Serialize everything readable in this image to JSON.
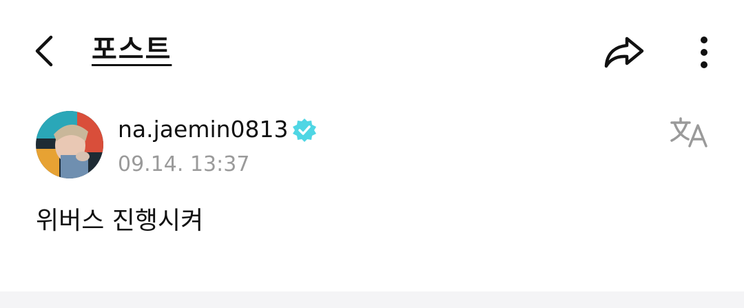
{
  "header": {
    "title": "포스트",
    "back_icon": "chevron-left-icon",
    "share_icon": "share-arrow-icon",
    "more_icon": "more-vertical-icon"
  },
  "post": {
    "author": "na.jaemin0813",
    "verified_icon": "verified-badge-icon",
    "verified_color": "#4fd6e4",
    "timestamp": "09.14. 13:37",
    "translate_icon": "translate-icon",
    "body": "위버스 진행시켜"
  },
  "colors": {
    "text": "#111111",
    "muted": "#9a9a9a",
    "divider": "#f4f4f6"
  }
}
